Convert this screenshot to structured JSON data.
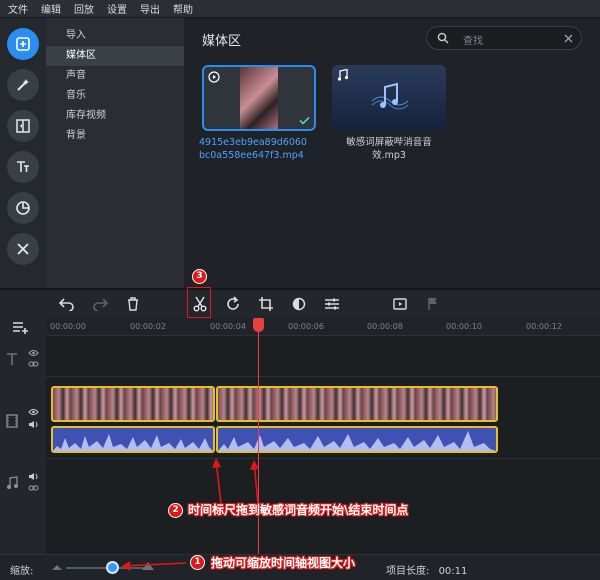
{
  "menu": {
    "items": [
      "文件",
      "编辑",
      "回放",
      "设置",
      "导出",
      "帮助"
    ]
  },
  "sidebar": {
    "categories": [
      "导入",
      "媒体区",
      "声音",
      "音乐",
      "库存视频",
      "背景"
    ],
    "active_index": 1
  },
  "media": {
    "title": "媒体区",
    "search_placeholder": "查找",
    "items": [
      {
        "name": "4915e3eb9ea89d6060bc0a558ee647f3.mp4",
        "line1": "4915e3eb9ea89d6060",
        "line2": "bc0a558ee647f3.mp4",
        "type": "video",
        "selected": true
      },
      {
        "name": "敏感词屏蔽哔消音音效.mp3",
        "line1": "敏感词屏蔽哔消音音",
        "line2": "效.mp3",
        "type": "audio",
        "selected": false
      }
    ]
  },
  "timeline": {
    "ruler_ticks": [
      "00:00:00",
      "00:00:02",
      "00:00:04",
      "00:00:06",
      "00:00:08",
      "00:00:10",
      "00:00:12"
    ]
  },
  "status": {
    "zoom_label": "缩放:",
    "project_length_label": "项目长度:",
    "project_length_value": "00:11"
  },
  "annotations": {
    "badge1": "1",
    "badge2": "2",
    "badge3": "3",
    "note1": "拖动可缩放时间轴视图大小",
    "note2": "时间标尺拖到敏感词音频开始\\结束时间点"
  },
  "colors": {
    "accent": "#2b8df0",
    "clip_border": "#e3c12a",
    "playhead": "#e84040",
    "annotation": "#e01818"
  }
}
